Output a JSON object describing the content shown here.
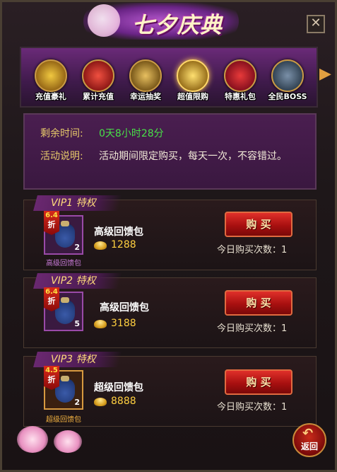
{
  "header": {
    "title": "七夕庆典",
    "close_label": "✕"
  },
  "tabs": [
    {
      "label": "充值豪礼",
      "color": "#c8a020"
    },
    {
      "label": "累计充值",
      "color": "#c83020"
    },
    {
      "label": "幸运抽奖",
      "color": "#b08a30"
    },
    {
      "label": "超值限购",
      "color": "#d0a030",
      "active": true
    },
    {
      "label": "特惠礼包",
      "color": "#c82a2a"
    },
    {
      "label": "全民BOSS",
      "color": "#4a6078"
    }
  ],
  "info": {
    "time_label": "剩余时间:",
    "time_value": "0天8小时28分",
    "desc_label": "活动说明:",
    "desc_value": "活动期间限定购买，每天一次，不容错过。"
  },
  "offers": [
    {
      "vip": "VIP1 特权",
      "discount": "6.4",
      "zhe": "折",
      "count": "2",
      "sub": "高级回馈包",
      "name": "高级回馈包",
      "price": "1288",
      "buy": "购 买",
      "today": "今日购买次数：1"
    },
    {
      "vip": "VIP2 特权",
      "discount": "6.4",
      "zhe": "折",
      "count": "5",
      "sub": "",
      "name": "高级回馈包",
      "price": "3188",
      "buy": "购 买",
      "today": "今日购买次数：1"
    },
    {
      "vip": "VIP3 特权",
      "discount": "4.5",
      "zhe": "折",
      "count": "2",
      "sub": "超级回馈包",
      "name": "超级回馈包",
      "price": "8888",
      "buy": "购 买",
      "today": "今日购买次数：1"
    }
  ],
  "footer": {
    "back_arrow": "↶",
    "back_label": "返回"
  }
}
